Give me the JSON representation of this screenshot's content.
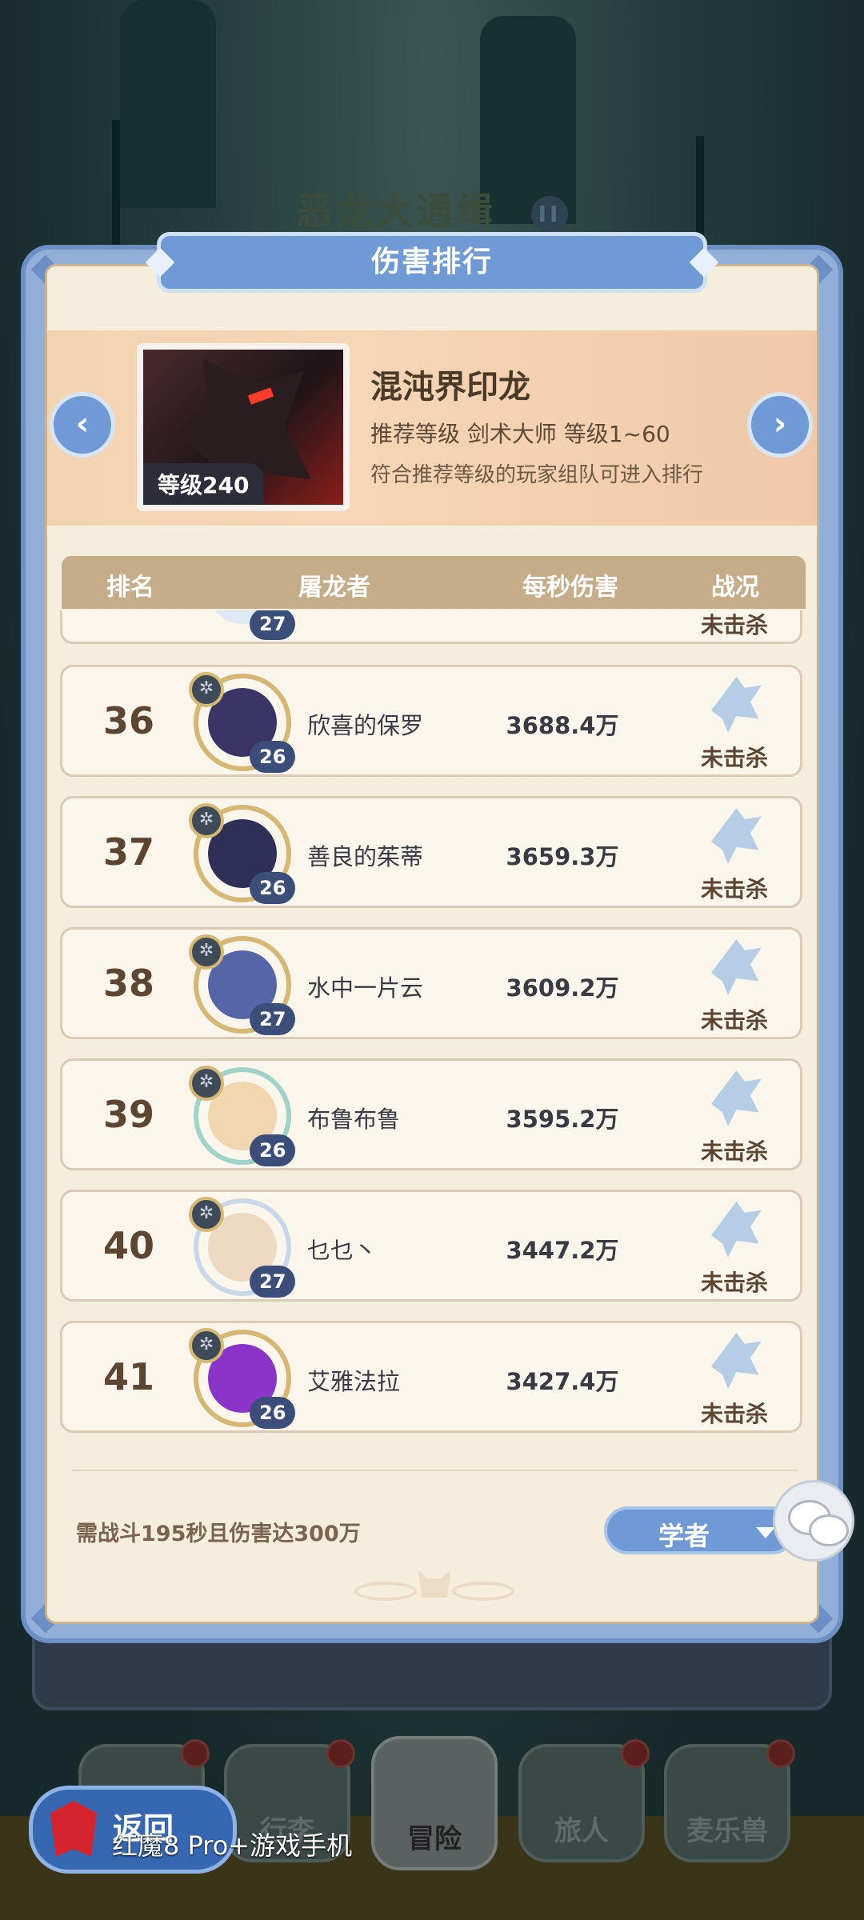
{
  "background": {
    "event_title": "恶龙大通缉",
    "event_badge": "II"
  },
  "modal": {
    "title": "伤害排行",
    "boss": {
      "name": "混沌界印龙",
      "level_badge": "等级240",
      "recommend": "推荐等级  剑术大师  等级1~60",
      "note": "符合推荐等级的玩家组队可进入排行"
    },
    "prev_icon": "chevron-left-icon",
    "next_icon": "chevron-right-icon",
    "columns": [
      "排名",
      "屠龙者",
      "每秒伤害",
      "战况"
    ],
    "rows": [
      {
        "rank": "",
        "name": "",
        "dps": "",
        "level": "27",
        "status": "未击杀",
        "face": "#dfe9f5"
      },
      {
        "rank": "36",
        "name": "欣喜的保罗",
        "dps": "3688.4万",
        "level": "26",
        "status": "未击杀",
        "face": "#3b3466"
      },
      {
        "rank": "37",
        "name": "善良的茱蒂",
        "dps": "3659.3万",
        "level": "26",
        "status": "未击杀",
        "face": "#2f3058"
      },
      {
        "rank": "38",
        "name": "水中一片云",
        "dps": "3609.2万",
        "level": "27",
        "status": "未击杀",
        "face": "#5466a8"
      },
      {
        "rank": "39",
        "name": "布鲁布鲁",
        "dps": "3595.2万",
        "level": "26",
        "status": "未击杀",
        "face": "#f0d7b0"
      },
      {
        "rank": "40",
        "name": "乜乜丶",
        "dps": "3447.2万",
        "level": "27",
        "status": "未击杀",
        "face": "#eed9c2"
      },
      {
        "rank": "41",
        "name": "艾雅法拉",
        "dps": "3427.4万",
        "level": "26",
        "status": "未击杀",
        "face": "#8a34c9"
      },
      {
        "rank": "",
        "name": "",
        "dps": "",
        "level": "",
        "status": "",
        "face": "#6a2a5c"
      }
    ],
    "footer_requirement": "需战斗195秒且伤害达300万",
    "class_filter": "学者"
  },
  "bottom_nav": {
    "items": [
      {
        "label": "",
        "icon": "castle-icon"
      },
      {
        "label": "行李",
        "icon": "backpack-icon"
      },
      {
        "label": "冒险",
        "icon": "crossed-swords-icon"
      },
      {
        "label": "旅人",
        "icon": "traveler-icon"
      },
      {
        "label": "麦乐兽",
        "icon": "pet-icon"
      }
    ],
    "back_label": "返回",
    "watermark": "红魔8 Pro+游戏手机"
  }
}
